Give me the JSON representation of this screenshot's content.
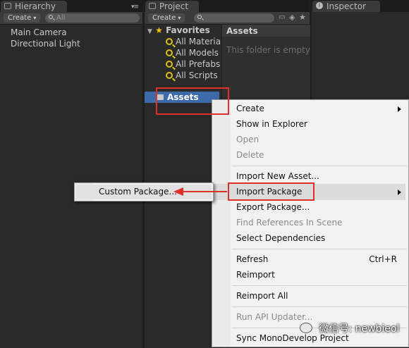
{
  "hierarchy": {
    "tab_label": "Hierarchy",
    "create_label": "Create",
    "search_placeholder": "All",
    "items": [
      "Main Camera",
      "Directional Light"
    ]
  },
  "project": {
    "tab_label": "Project",
    "create_label": "Create",
    "favorites_label": "Favorites",
    "favorites": [
      "All Material",
      "All Models",
      "All Prefabs",
      "All Scripts"
    ],
    "assets_label": "Assets",
    "assets_header": "Assets",
    "empty_text": "This folder is empty"
  },
  "inspector": {
    "tab_label": "Inspector"
  },
  "context_menu": {
    "items": {
      "create": "Create",
      "show_in_explorer": "Show in Explorer",
      "open": "Open",
      "delete": "Delete",
      "import_new_asset": "Import New Asset...",
      "import_package": "Import Package",
      "export_package": "Export Package...",
      "find_references": "Find References In Scene",
      "select_dependencies": "Select Dependencies",
      "refresh": "Refresh",
      "refresh_shortcut": "Ctrl+R",
      "reimport": "Reimport",
      "reimport_all": "Reimport All",
      "run_api_updater": "Run API Updater...",
      "sync_monodevelop": "Sync MonoDevelop Project"
    }
  },
  "submenu": {
    "custom_package": "Custom Package..."
  },
  "watermark": {
    "text": "微信号: newbieol"
  },
  "colors": {
    "highlight_red": "#e0302a",
    "selection_blue": "#3d6aa8",
    "favorites_star": "#f0c419"
  }
}
